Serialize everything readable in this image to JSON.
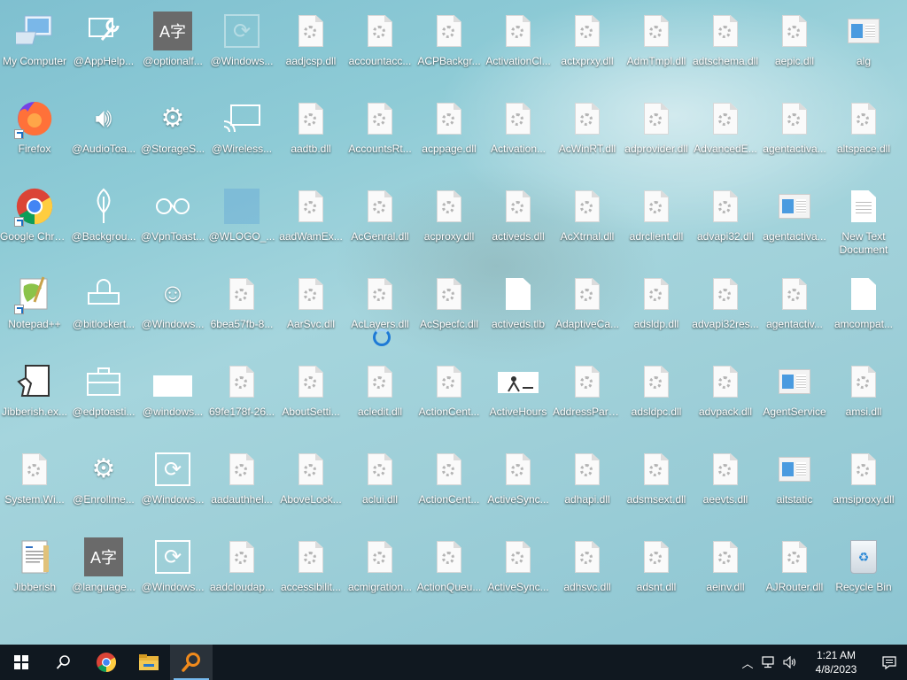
{
  "desktop": {
    "columns": [
      [
        "My Computer",
        "Firefox",
        "Google Chrome",
        "Notepad++",
        "Jibberish.ex...",
        "System.Wi...",
        "Jibberish"
      ],
      [
        "@AppHelp...",
        "@AudioToa...",
        "@Backgrou...",
        "@bitlockert...",
        "@edptoasti...",
        "@Enrollme...",
        "@language..."
      ],
      [
        "@optionalf...",
        "@StorageS...",
        "@VpnToast...",
        "@Windows...",
        "@windows...",
        "@Windows...",
        "@Windows..."
      ],
      [
        "@Windows...",
        "@Wireless...",
        "@WLOGO_...",
        "6bea57fb-8...",
        "69fe178f-26...",
        "aadauthhel...",
        "aadcloudap..."
      ],
      [
        "aadjcsp.dll",
        "aadtb.dll",
        "aadWamEx...",
        "AarSvc.dll",
        "AboutSetti...",
        "AboveLock...",
        "accessibilit..."
      ],
      [
        "accountacc...",
        "AccountsRt...",
        "AcGenral.dll",
        "AcLayers.dll",
        "acledit.dll",
        "aclui.dll",
        "acmigration..."
      ],
      [
        "ACPBackgr...",
        "acppage.dll",
        "acproxy.dll",
        "AcSpecfc.dll",
        "ActionCent...",
        "ActionCent...",
        "ActionQueu..."
      ],
      [
        "ActivationCl...",
        "Activation...",
        "activeds.dll",
        "activeds.tlb",
        "ActiveHours",
        "ActiveSync...",
        "ActiveSync..."
      ],
      [
        "actxprxy.dll",
        "AcWinRT.dll",
        "AcXtrnal.dll",
        "AdaptiveCa...",
        "AddressPars...",
        "adhapi.dll",
        "adhsvc.dll"
      ],
      [
        "AdmTmpl.dll",
        "adprovider.dll",
        "adrclient.dll",
        "adsldp.dll",
        "adsldpc.dll",
        "adsmsext.dll",
        "adsnt.dll"
      ],
      [
        "adtschema.dll",
        "AdvancedE...",
        "advapi32.dll",
        "advapi32res...",
        "advpack.dll",
        "aeevts.dll",
        "aeinv.dll"
      ],
      [
        "aepic.dll",
        "agentactiva...",
        "agentactiva...",
        "agentactiv...",
        "AgentService",
        "aitstatic",
        "AJRouter.dll"
      ],
      [
        "alg",
        "altspace.dll",
        "New Text Document",
        "amcompat...",
        "amsi.dll",
        "amsiproxy.dll",
        "Recycle Bin"
      ]
    ],
    "icons": [
      [
        "computer",
        "firefox",
        "chrome",
        "notepadpp",
        "app-exe",
        "dll",
        "text-doc"
      ],
      [
        "wrench",
        "speaker",
        "leaf",
        "lock",
        "briefcase",
        "gear",
        "a-char"
      ],
      [
        "a-char",
        "gear",
        "vpn",
        "smiley",
        "blank-window",
        "refresh",
        "refresh"
      ],
      [
        "refresh-faded",
        "wireless",
        "win-logo",
        "dll",
        "dll",
        "dll",
        "dll"
      ],
      [
        "dll",
        "dll",
        "dll",
        "dll",
        "dll",
        "dll",
        "dll"
      ],
      [
        "dll",
        "dll",
        "dll",
        "dll",
        "dll",
        "dll",
        "dll"
      ],
      [
        "dll",
        "dll",
        "dll",
        "dll",
        "dll",
        "dll",
        "dll"
      ],
      [
        "dll",
        "dll",
        "dll",
        "blank",
        "activehours",
        "dll",
        "dll"
      ],
      [
        "dll",
        "dll",
        "dll",
        "dll",
        "dll",
        "dll",
        "dll"
      ],
      [
        "dll",
        "dll",
        "dll",
        "dll",
        "dll",
        "dll",
        "dll"
      ],
      [
        "dll",
        "dll",
        "dll",
        "dll",
        "dll",
        "dll",
        "dll"
      ],
      [
        "dll",
        "dll",
        "window-app",
        "dll",
        "window-app",
        "window-app",
        "dll"
      ],
      [
        "window-app",
        "dll",
        "text-file",
        "blank",
        "dll",
        "dll",
        "recycle-bin"
      ]
    ]
  },
  "taskbar": {
    "apps": [
      {
        "name": "start",
        "icon": "windows-logo-icon"
      },
      {
        "name": "search",
        "icon": "search-icon"
      },
      {
        "name": "chrome",
        "icon": "chrome-icon"
      },
      {
        "name": "file-explorer",
        "icon": "folder-icon"
      },
      {
        "name": "search-app",
        "icon": "magnifier-orange-icon",
        "active": true
      }
    ],
    "tray": {
      "time": "1:21 AM",
      "date": "4/8/2023"
    }
  }
}
